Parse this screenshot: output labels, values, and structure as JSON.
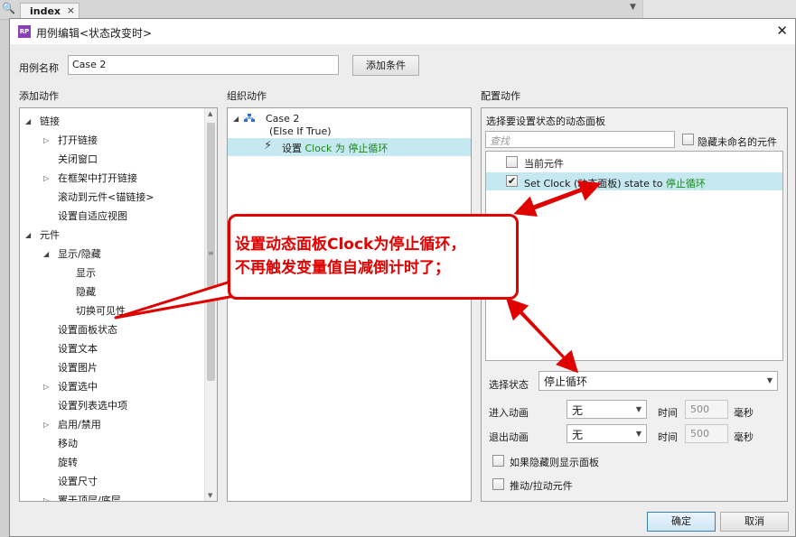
{
  "background": {
    "tab_label": "index",
    "tab_close": "×",
    "search_glyph": "🔍",
    "arrow_glyph": "▼",
    "right_glyph": "⇱"
  },
  "dialog": {
    "icon_text": "RP",
    "title": "用例编辑<状态改变时>",
    "close_glyph": "✕"
  },
  "header": {
    "case_name_label": "用例名称",
    "case_name_value": "Case 2",
    "add_condition_button": "添加条件"
  },
  "add_actions": {
    "title": "添加动作",
    "items": [
      {
        "label": "链接",
        "expander": "◢"
      },
      {
        "label": "打开链接",
        "expander": "▷"
      },
      {
        "label": "关闭窗口",
        "expander": ""
      },
      {
        "label": "在框架中打开链接",
        "expander": "▷"
      },
      {
        "label": "滚动到元件<锚链接>",
        "expander": ""
      },
      {
        "label": "设置自适应视图",
        "expander": ""
      },
      {
        "label": "元件",
        "expander": "◢"
      },
      {
        "label": "显示/隐藏",
        "expander": "◢"
      },
      {
        "label": "显示",
        "expander": ""
      },
      {
        "label": "隐藏",
        "expander": ""
      },
      {
        "label": "切换可见性",
        "expander": ""
      },
      {
        "label": "设置面板状态",
        "expander": ""
      },
      {
        "label": "设置文本",
        "expander": ""
      },
      {
        "label": "设置图片",
        "expander": ""
      },
      {
        "label": "设置选中",
        "expander": "▷"
      },
      {
        "label": "设置列表选中项",
        "expander": ""
      },
      {
        "label": "启用/禁用",
        "expander": "▷"
      },
      {
        "label": "移动",
        "expander": ""
      },
      {
        "label": "旋转",
        "expander": ""
      },
      {
        "label": "设置尺寸",
        "expander": ""
      },
      {
        "label": "置于顶层/底层",
        "expander": "▷"
      }
    ],
    "scroll_up": "▲",
    "scroll_down": "▼",
    "scroll_grip": "≡"
  },
  "organize": {
    "title": "组织动作",
    "case_expander": "◢",
    "case_name": "Case 2",
    "case_condition": "(Else If True)",
    "action_icon": "⚡",
    "action_prefix": "设置 ",
    "action_target": "Clock 为 停止循环"
  },
  "configure": {
    "title": "配置动作",
    "subtitle": "选择要设置状态的动态面板",
    "search_placeholder": "查找",
    "hide_unnamed_label": "隐藏未命名的元件",
    "list": [
      {
        "label": "当前元件",
        "checked": false,
        "check_glyph": ""
      },
      {
        "label_prefix": "Set Clock (动态面板) state to ",
        "label_state": "停止循环",
        "checked": true,
        "check_glyph": "✔"
      }
    ],
    "select_state_label": "选择状态",
    "select_state_value": "停止循环",
    "dropdown_arrow": "▼",
    "enter_anim_label": "进入动画",
    "enter_anim_value": "无",
    "exit_anim_label": "退出动画",
    "exit_anim_value": "无",
    "time_label": "时间",
    "time_value": "500",
    "ms_label": "毫秒",
    "show_panel_if_hidden": "如果隐藏则显示面板",
    "push_pull_widgets": "推动/拉动元件"
  },
  "footer": {
    "ok_button": "确定",
    "cancel_button": "取消"
  },
  "annotation": {
    "line1": "设置动态面板Clock为停止循环，",
    "line2": "不再触发变量值自减倒计时了；",
    "color": "#e00000"
  }
}
